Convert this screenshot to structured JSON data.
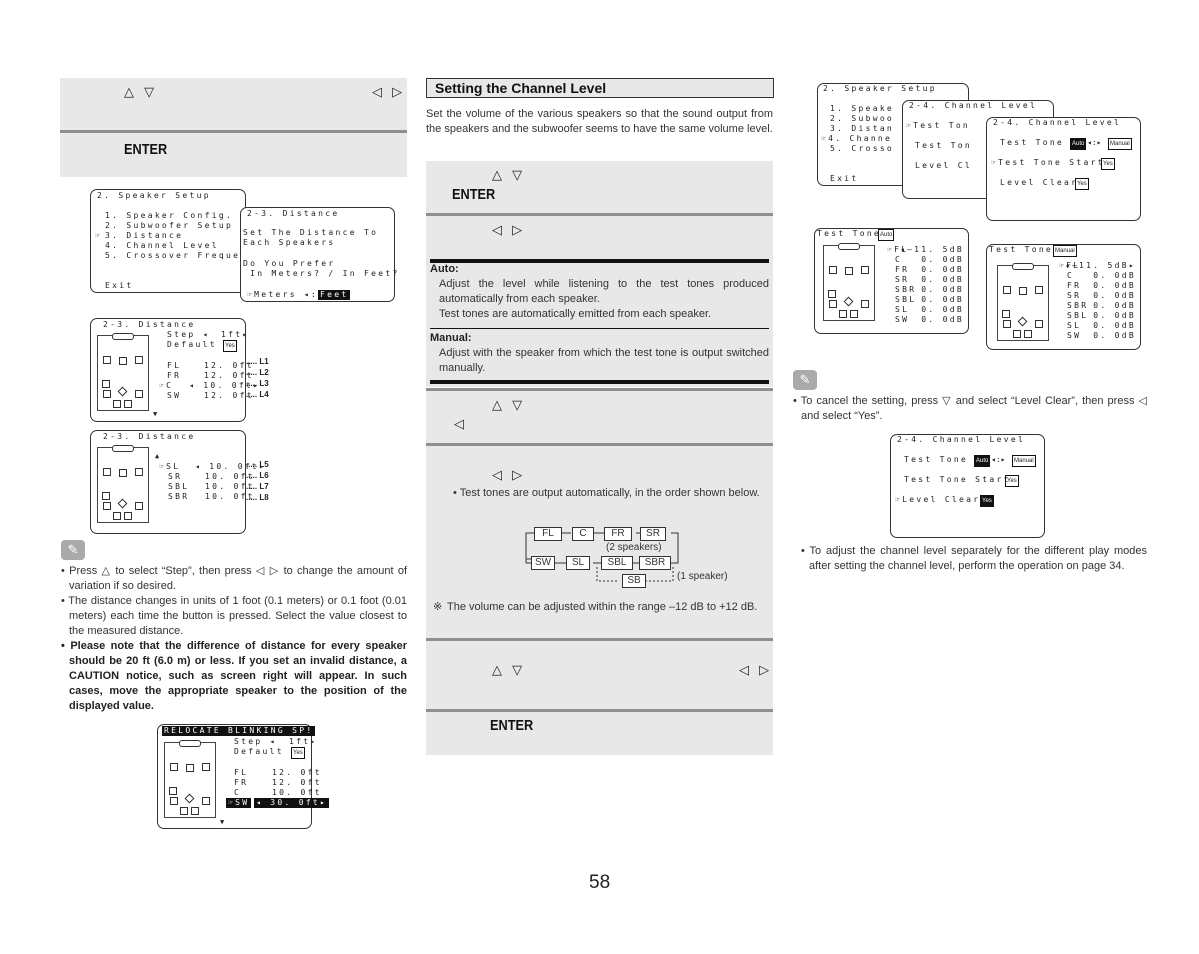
{
  "page_number": "58",
  "left_column": {
    "step_box_1": {
      "updown": "△ ▽",
      "leftright": "◁ ▷"
    },
    "step_box_2": {
      "enter": "ENTER"
    },
    "screen_speaker_setup": {
      "title": "2. Speaker Setup",
      "items": [
        "1. Speaker Config.",
        "2. Subwoofer Setup",
        "3. Distance",
        "4. Channel Level",
        "5. Crossover Freque"
      ],
      "cursor_item": "☞",
      "exit": "Exit"
    },
    "screen_distance_units": {
      "title": "2-3. Distance",
      "line1": "Set The Distance To",
      "line2": "Each Speakers",
      "line3": "Do You Prefer",
      "line4": " In Meters? / In Feet?",
      "option_a": "☞Meters ◂:▸",
      "option_b": "Feet"
    },
    "screen_distance_1": {
      "title": "2-3. Distance",
      "step_label": "Step ◂",
      "step_value": "1ft▸",
      "default_label": "Default",
      "default_value": "Yes",
      "rows": [
        {
          "name": "FL",
          "value": "12. 0ft",
          "label": "L1"
        },
        {
          "name": "FR",
          "value": "12. 0ft",
          "label": "L2"
        },
        {
          "name": "☞C",
          "value": "◂ 10. 0ft▸",
          "label": "L3"
        },
        {
          "name": "SW",
          "value": "12. 0ft",
          "label": "L4"
        }
      ]
    },
    "screen_distance_2": {
      "title": "2-3. Distance",
      "rows": [
        {
          "name": "☞SL",
          "value": "◂ 10. 0ft▸",
          "label": "L5"
        },
        {
          "name": "SR",
          "value": "10. 0ft",
          "label": "L6"
        },
        {
          "name": "SBL",
          "value": "10. 0ft",
          "label": "L7"
        },
        {
          "name": "SBR",
          "value": "10. 0ft",
          "label": "L8"
        }
      ]
    },
    "notes": [
      "Press △ to select “Step”, then press ◁ ▷ to change the amount of variation if so desired.",
      "The distance changes in units of 1 foot (0.1 meters) or 0.1 foot (0.01 meters) each time the button is pressed. Select the value closest to the measured distance.",
      "Please note that the difference of distance for every speaker should be 20 ft (6.0 m) or less. If you set an invalid distance, a CAUTION notice, such as screen right will appear. In such cases, move the appropriate speaker to the position of the displayed value."
    ],
    "screen_caution": {
      "title": "RELOCATE BLINKING SP!",
      "step_label": "Step ◂",
      "step_value": "1ft▸",
      "default_label": "Default",
      "default_value": "Yes",
      "rows": [
        {
          "name": "FL",
          "value": "12. 0ft"
        },
        {
          "name": "FR",
          "value": "12. 0ft"
        },
        {
          "name": "C",
          "value": "10. 0ft"
        },
        {
          "name": "☞SW",
          "value": "◂ 30. 0ft▸"
        }
      ]
    }
  },
  "middle_column": {
    "section_title": "Setting the Channel Level",
    "intro": "Set the volume of the various speakers so that the sound output from the speakers and the subwoofer seems to have the same volume level.",
    "step1": {
      "updown": "△ ▽",
      "enter": "ENTER"
    },
    "step2": {
      "leftright": "◁ ▷"
    },
    "auto_label": "Auto:",
    "auto_text_1": "Adjust the level while listening to the test tones produced automatically from each speaker.",
    "auto_text_2": "Test tones are automatically emitted from each speaker.",
    "manual_label": "Manual:",
    "manual_text": "Adjust with the speaker from which the test tone is output switched manually.",
    "step3": {
      "updown": "△ ▽",
      "left": "◁"
    },
    "step4": {
      "leftright": "◁ ▷",
      "bullet": "Test tones are output automatically, in the order shown below."
    },
    "flow": {
      "top": [
        "FL",
        "C",
        "FR",
        "SR"
      ],
      "bottom": [
        "SW",
        "SL",
        "SBL",
        "SBR"
      ],
      "two_speakers": "(2 speakers)",
      "one_speaker_box": "SB",
      "one_speaker": "(1 speaker)"
    },
    "range_note_mark": "※",
    "range_note": "The volume can be adjusted within the range –12 dB to +12 dB.",
    "step5": {
      "updown": "△ ▽",
      "leftright": "◁ ▷"
    },
    "step6": {
      "enter": "ENTER"
    }
  },
  "right_column": {
    "screen_setup_small": {
      "title": "2. Speaker Setup",
      "items": [
        "1. Speake",
        "2. Subwoo",
        "3. Distan",
        "☞4. Channe",
        "5. Crosso"
      ],
      "exit": "Exit"
    },
    "screen_channel_mid": {
      "title": "2-4. Channel Level",
      "items": [
        "☞Test Ton",
        "Test Ton",
        "Level Cl"
      ]
    },
    "screen_channel_front": {
      "title": "2-4. Channel Level",
      "test_tone": "Test Tone",
      "auto": "Auto",
      "sep": "◂:▸",
      "manual": "Manual",
      "start": "☞Test Tone Start",
      "start_val": "Yes",
      "clear": "Level Clear",
      "clear_val": "Yes"
    },
    "screen_testtone_auto": {
      "title": "Test Tone",
      "mode": "Auto",
      "rows": [
        {
          "name": "☞FL",
          "value": "◂–11. 5dB"
        },
        {
          "name": "C",
          "value": "0. 0dB"
        },
        {
          "name": "FR",
          "value": "0. 0dB"
        },
        {
          "name": "SR",
          "value": "0. 0dB"
        },
        {
          "name": "SBR",
          "value": "0. 0dB"
        },
        {
          "name": "SBL",
          "value": "0. 0dB"
        },
        {
          "name": "SL",
          "value": "0. 0dB"
        },
        {
          "name": "SW",
          "value": "0. 0dB"
        }
      ]
    },
    "screen_testtone_manual": {
      "title": "Test Tone",
      "mode": "Manual",
      "rows": [
        {
          "name": "☞FL",
          "value": "◂–11. 5dB▸"
        },
        {
          "name": "C",
          "value": "0. 0dB"
        },
        {
          "name": "FR",
          "value": "0. 0dB"
        },
        {
          "name": "SR",
          "value": "0. 0dB"
        },
        {
          "name": "SBR",
          "value": "0. 0dB"
        },
        {
          "name": "SBL",
          "value": "0. 0dB"
        },
        {
          "name": "SL",
          "value": "0. 0dB"
        },
        {
          "name": "SW",
          "value": "0. 0dB"
        }
      ]
    },
    "notes": [
      "To cancel the setting, press ▽ and select “Level Clear”, then press ◁ and select “Yes”.",
      "To adjust the channel level separately for the different play modes after setting the channel level, perform the operation on page 34."
    ],
    "screen_clear": {
      "title": "2-4. Channel Level",
      "test_tone": "Test Tone",
      "auto": "Auto",
      "sep": "◂:▸",
      "manual": "Manual",
      "start": "Test Tone Start",
      "start_val": "Yes",
      "clear": "☞Level Clear",
      "clear_val": "Yes"
    }
  }
}
